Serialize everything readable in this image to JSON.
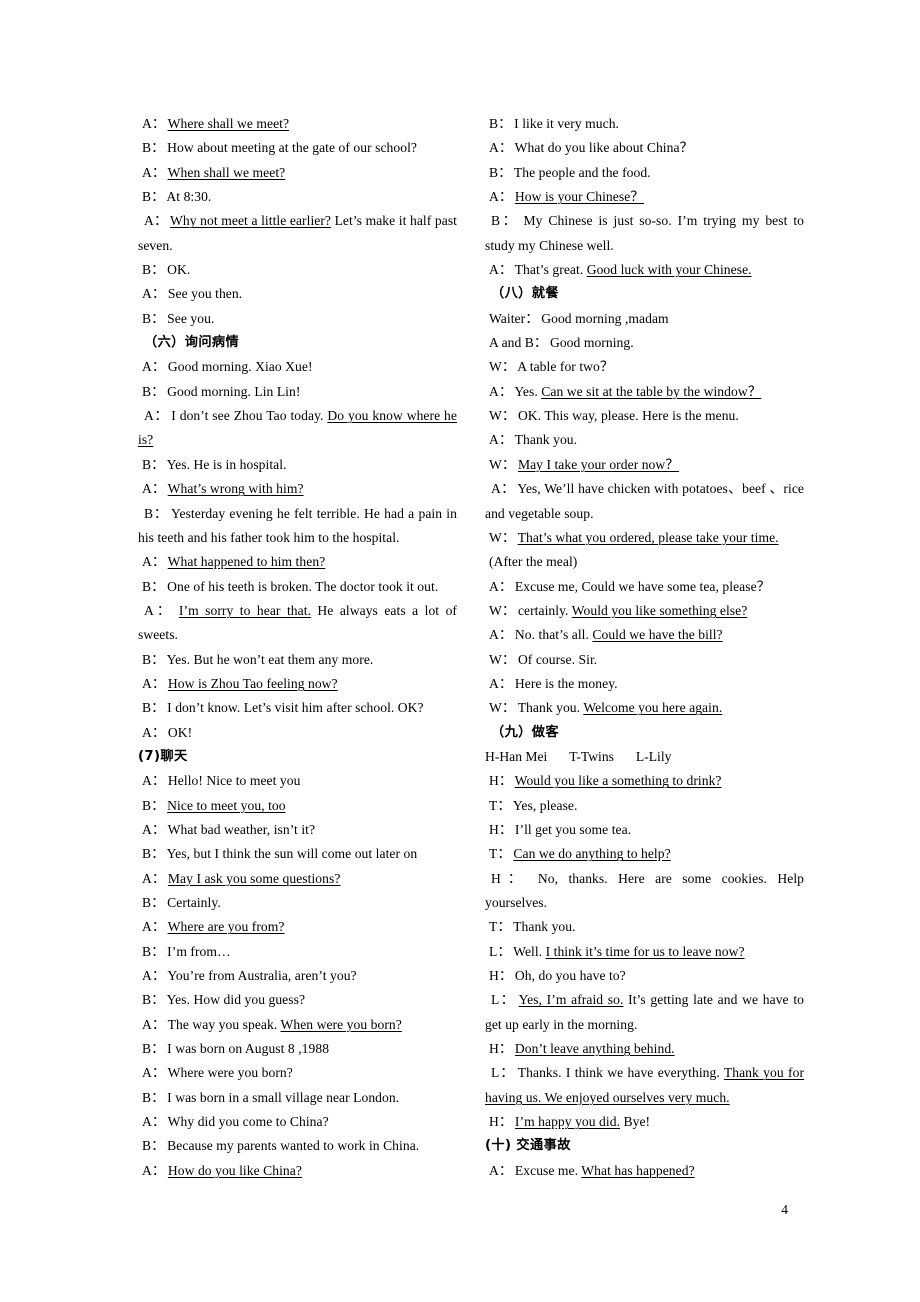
{
  "document": {
    "page_number": "4",
    "language_mix": "English dialogues with Chinese section headings"
  },
  "left_column": [
    {
      "type": "line",
      "speaker": "A",
      "sep": "：",
      "segments": [
        {
          "text": "Where shall we meet?",
          "underline": true
        }
      ]
    },
    {
      "type": "line",
      "speaker": "B",
      "sep": "：",
      "segments": [
        {
          "text": "How about meeting at the gate of our school?",
          "underline": false
        }
      ]
    },
    {
      "type": "line",
      "speaker": "A",
      "sep": "：",
      "segments": [
        {
          "text": "When shall we meet?",
          "underline": true
        }
      ]
    },
    {
      "type": "line",
      "speaker": "B",
      "sep": "：",
      "segments": [
        {
          "text": "At 8:30.",
          "underline": false
        }
      ]
    },
    {
      "type": "justify",
      "speaker": "A",
      "sep": "：",
      "segments": [
        {
          "text": "Why not meet a little earlier?",
          "underline": true
        },
        {
          "text": " Let’s make it half past seven.",
          "underline": false
        }
      ]
    },
    {
      "type": "line",
      "speaker": "B",
      "sep": "：",
      "segments": [
        {
          "text": "OK.",
          "underline": false
        }
      ]
    },
    {
      "type": "line",
      "speaker": "A",
      "sep": "：",
      "segments": [
        {
          "text": "See you then.",
          "underline": false
        }
      ]
    },
    {
      "type": "line",
      "speaker": "B",
      "sep": "：",
      "segments": [
        {
          "text": "See you.",
          "underline": false
        }
      ]
    },
    {
      "type": "heading",
      "text": "（六）询问病情"
    },
    {
      "type": "line",
      "speaker": "A",
      "sep": "：",
      "segments": [
        {
          "text": "Good morning. Xiao Xue!",
          "underline": false
        }
      ]
    },
    {
      "type": "line",
      "speaker": "B",
      "sep": "：",
      "segments": [
        {
          "text": "Good morning. Lin Lin!",
          "underline": false
        }
      ]
    },
    {
      "type": "justify",
      "speaker": "A",
      "sep": "：",
      "segments": [
        {
          "text": "I don’t see Zhou Tao today. ",
          "underline": false
        },
        {
          "text": "Do you know where he is?",
          "underline": true
        }
      ]
    },
    {
      "type": "line",
      "speaker": "B",
      "sep": "：",
      "segments": [
        {
          "text": "Yes. He is in hospital.",
          "underline": false
        }
      ]
    },
    {
      "type": "line",
      "speaker": "A",
      "sep": "：",
      "segments": [
        {
          "text": "What’s wrong with him?",
          "underline": true
        }
      ]
    },
    {
      "type": "justify",
      "speaker": "B",
      "sep": "：",
      "segments": [
        {
          "text": "Yesterday evening he felt terrible. He had a pain in his teeth and his father took him to the hospital.",
          "underline": false
        }
      ]
    },
    {
      "type": "line",
      "speaker": "A",
      "sep": "：",
      "segments": [
        {
          "text": "What happened to him then?",
          "underline": true
        }
      ]
    },
    {
      "type": "line",
      "speaker": "B",
      "sep": "：",
      "segments": [
        {
          "text": "One of his teeth is broken. The doctor took it out.",
          "underline": false
        }
      ]
    },
    {
      "type": "justify",
      "speaker": "A",
      "sep": "：",
      "segments": [
        {
          "text": "I’m sorry to hear that.",
          "underline": true
        },
        {
          "text": " He always eats a lot of sweets.",
          "underline": false
        }
      ]
    },
    {
      "type": "line",
      "speaker": "B",
      "sep": "：",
      "segments": [
        {
          "text": "Yes. But he won’t eat them any more.",
          "underline": false
        }
      ]
    },
    {
      "type": "line",
      "speaker": "A",
      "sep": "：",
      "segments": [
        {
          "text": "How is Zhou Tao feeling now?",
          "underline": true
        }
      ]
    },
    {
      "type": "line",
      "speaker": "B",
      "sep": "：",
      "segments": [
        {
          "text": "I don’t know. Let’s visit him after school. OK?",
          "underline": false
        }
      ]
    },
    {
      "type": "line",
      "speaker": "A",
      "sep": "：",
      "segments": [
        {
          "text": "OK!",
          "underline": false
        }
      ]
    },
    {
      "type": "heading",
      "text": "(7)聊天",
      "nopad": true
    },
    {
      "type": "line",
      "speaker": "A",
      "sep": "：",
      "segments": [
        {
          "text": "Hello! Nice to meet you",
          "underline": false
        }
      ]
    },
    {
      "type": "line",
      "speaker": "B",
      "sep": "：",
      "segments": [
        {
          "text": "Nice to meet you, too",
          "underline": true
        }
      ]
    },
    {
      "type": "line",
      "speaker": "A",
      "sep": "：",
      "segments": [
        {
          "text": "What bad weather, isn’t it?",
          "underline": false
        }
      ]
    },
    {
      "type": "line",
      "speaker": "B",
      "sep": "：",
      "segments": [
        {
          "text": "Yes, but I think the sun will come out later on",
          "underline": false
        }
      ]
    },
    {
      "type": "line",
      "speaker": "A",
      "sep": "：",
      "segments": [
        {
          "text": "May I ask you some questions?",
          "underline": true
        }
      ]
    },
    {
      "type": "line",
      "speaker": "B",
      "sep": "：",
      "segments": [
        {
          "text": "Certainly.",
          "underline": false
        }
      ]
    },
    {
      "type": "line",
      "speaker": "A",
      "sep": "：",
      "segments": [
        {
          "text": "Where are you from?",
          "underline": true
        }
      ]
    },
    {
      "type": "line",
      "speaker": "B",
      "sep": "：",
      "segments": [
        {
          "text": "I’m from…",
          "underline": false
        }
      ]
    },
    {
      "type": "line",
      "speaker": "A",
      "sep": "：",
      "segments": [
        {
          "text": "You’re from Australia, aren’t you?",
          "underline": false
        }
      ]
    },
    {
      "type": "line",
      "speaker": "B",
      "sep": "：",
      "segments": [
        {
          "text": "Yes. How did you guess?",
          "underline": false
        }
      ]
    },
    {
      "type": "line",
      "speaker": "A",
      "sep": "：",
      "segments": [
        {
          "text": "The way you speak. ",
          "underline": false
        },
        {
          "text": "When were you born?",
          "underline": true
        }
      ]
    },
    {
      "type": "line",
      "speaker": "B",
      "sep": "：",
      "segments": [
        {
          "text": "I was born on August 8 ,1988",
          "underline": false
        }
      ]
    },
    {
      "type": "line",
      "speaker": "A",
      "sep": "：",
      "segments": [
        {
          "text": "Where were you born?",
          "underline": false
        }
      ]
    },
    {
      "type": "line",
      "speaker": "B",
      "sep": "：",
      "segments": [
        {
          "text": "I was born in a small village near London.",
          "underline": false
        }
      ]
    },
    {
      "type": "line",
      "speaker": "A",
      "sep": "：",
      "segments": [
        {
          "text": "Why did you come to China?",
          "underline": false
        }
      ]
    },
    {
      "type": "line",
      "speaker": "B",
      "sep": "：",
      "segments": [
        {
          "text": "Because my parents wanted to work in China.",
          "underline": false
        }
      ]
    },
    {
      "type": "line",
      "speaker": "A",
      "sep": "：",
      "segments": [
        {
          "text": "How do you like China?",
          "underline": true
        }
      ]
    }
  ],
  "right_column": [
    {
      "type": "line",
      "speaker": "B",
      "sep": "：",
      "segments": [
        {
          "text": "I like it very much.",
          "underline": false
        }
      ]
    },
    {
      "type": "line",
      "speaker": "A",
      "sep": "：",
      "segments": [
        {
          "text": "What do you like about China？",
          "underline": false
        }
      ]
    },
    {
      "type": "line",
      "speaker": "B",
      "sep": "：",
      "segments": [
        {
          "text": "The people and the food.",
          "underline": false
        }
      ]
    },
    {
      "type": "line",
      "speaker": "A",
      "sep": "：",
      "segments": [
        {
          "text": "How is your Chinese？ ",
          "underline": true
        }
      ]
    },
    {
      "type": "justify",
      "speaker": "B",
      "sep": "：",
      "segments": [
        {
          "text": "My Chinese is just so-so. I’m trying my best to study my Chinese well.",
          "underline": false
        }
      ]
    },
    {
      "type": "line",
      "speaker": "A",
      "sep": "：",
      "segments": [
        {
          "text": "That’s great. ",
          "underline": false
        },
        {
          "text": "Good luck with your Chinese.",
          "underline": true
        }
      ]
    },
    {
      "type": "heading",
      "text": "（八）就餐"
    },
    {
      "type": "line",
      "speaker": "Waiter",
      "sep": "：",
      "segments": [
        {
          "text": "Good morning ,madam",
          "underline": false
        }
      ]
    },
    {
      "type": "line",
      "speaker": "A and B",
      "sep": "：",
      "segments": [
        {
          "text": "Good morning.",
          "underline": false
        }
      ]
    },
    {
      "type": "line",
      "speaker": "W",
      "sep": "：",
      "segments": [
        {
          "text": "A table for two？",
          "underline": false
        }
      ]
    },
    {
      "type": "line",
      "speaker": "A",
      "sep": "：",
      "segments": [
        {
          "text": "Yes. ",
          "underline": false
        },
        {
          "text": "Can we sit at the table by the window？ ",
          "underline": true
        }
      ]
    },
    {
      "type": "line",
      "speaker": "W",
      "sep": "：",
      "segments": [
        {
          "text": "OK. This way, please. Here is the menu.",
          "underline": false
        }
      ]
    },
    {
      "type": "line",
      "speaker": "A",
      "sep": "：",
      "segments": [
        {
          "text": "Thank you.",
          "underline": false
        }
      ]
    },
    {
      "type": "line",
      "speaker": "W",
      "sep": "：",
      "segments": [
        {
          "text": "May I take your order now？ ",
          "underline": true
        }
      ]
    },
    {
      "type": "justify",
      "speaker": "A",
      "sep": "：",
      "segments": [
        {
          "text": "Yes, We’ll have chicken with potatoes、beef 、rice and vegetable soup.",
          "underline": false
        }
      ]
    },
    {
      "type": "line",
      "speaker": "W",
      "sep": "：",
      "segments": [
        {
          "text": "That’s what you ordered, please take your time.",
          "underline": true
        }
      ]
    },
    {
      "type": "plain",
      "text": "(After the meal)"
    },
    {
      "type": "line",
      "speaker": "A",
      "sep": "：",
      "segments": [
        {
          "text": "Excuse me, Could we have some tea, please？",
          "underline": false
        }
      ]
    },
    {
      "type": "line",
      "speaker": "W",
      "sep": "：",
      "segments": [
        {
          "text": "certainly. ",
          "underline": false
        },
        {
          "text": "Would you like something else?",
          "underline": true
        }
      ]
    },
    {
      "type": "line",
      "speaker": "A",
      "sep": "：",
      "segments": [
        {
          "text": "No. that’s all. ",
          "underline": false
        },
        {
          "text": "Could we have the bill?",
          "underline": true
        }
      ]
    },
    {
      "type": "line",
      "speaker": "W",
      "sep": "：",
      "segments": [
        {
          "text": "Of course. Sir.",
          "underline": false
        }
      ]
    },
    {
      "type": "line",
      "speaker": "A",
      "sep": "：",
      "segments": [
        {
          "text": "Here is the money.",
          "underline": false
        }
      ]
    },
    {
      "type": "line",
      "speaker": "W",
      "sep": "：",
      "segments": [
        {
          "text": "Thank you. ",
          "underline": false
        },
        {
          "text": "Welcome you here again.",
          "underline": true
        }
      ]
    },
    {
      "type": "heading",
      "text": "（九）做客"
    },
    {
      "type": "roles",
      "roles": [
        "H-Han Mei",
        "T-Twins",
        "L-Lily"
      ]
    },
    {
      "type": "line",
      "speaker": "H",
      "sep": "：",
      "segments": [
        {
          "text": "Would you like a something to drink?",
          "underline": true
        }
      ]
    },
    {
      "type": "line",
      "speaker": "T",
      "sep": "：",
      "segments": [
        {
          "text": "Yes, please.",
          "underline": false
        }
      ]
    },
    {
      "type": "line",
      "speaker": "H",
      "sep": "：",
      "segments": [
        {
          "text": "I’ll get you some tea.",
          "underline": false
        }
      ]
    },
    {
      "type": "line",
      "speaker": "T",
      "sep": "：",
      "segments": [
        {
          "text": "Can we do anything to help?",
          "underline": true
        }
      ]
    },
    {
      "type": "justify",
      "speaker": "H",
      "sep": "：",
      "segments": [
        {
          "text": "No, thanks. Here are some cookies. Help yourselves.",
          "underline": false
        }
      ]
    },
    {
      "type": "line",
      "speaker": "T",
      "sep": "：",
      "segments": [
        {
          "text": "Thank you.",
          "underline": false
        }
      ]
    },
    {
      "type": "line",
      "speaker": "L",
      "sep": "：",
      "segments": [
        {
          "text": "Well. ",
          "underline": false
        },
        {
          "text": "I think it’s time for us to leave now?",
          "underline": true
        }
      ]
    },
    {
      "type": "line",
      "speaker": "H",
      "sep": "：",
      "segments": [
        {
          "text": "Oh, do you have to?",
          "underline": false
        }
      ]
    },
    {
      "type": "justify",
      "speaker": "L",
      "sep": "：",
      "segments": [
        {
          "text": "Yes, I’m afraid so.",
          "underline": true
        },
        {
          "text": " It’s getting late and we have to get up early in the morning.",
          "underline": false
        }
      ]
    },
    {
      "type": "line",
      "speaker": "H",
      "sep": "：",
      "segments": [
        {
          "text": "Don’t leave anything behind.",
          "underline": true
        }
      ]
    },
    {
      "type": "justify",
      "speaker": "L",
      "sep": "：",
      "segments": [
        {
          "text": "Thanks. I think we have everything. ",
          "underline": false
        },
        {
          "text": "Thank you for having us. We enjoyed ourselves very much.",
          "underline": true
        }
      ]
    },
    {
      "type": "line",
      "speaker": "H",
      "sep": "：",
      "segments": [
        {
          "text": "I’m happy you did.",
          "underline": true
        },
        {
          "text": " Bye!",
          "underline": false
        }
      ]
    },
    {
      "type": "heading",
      "text": "(十) 交通事故",
      "nopad": true
    },
    {
      "type": "line",
      "speaker": "A",
      "sep": "：",
      "segments": [
        {
          "text": "Excuse me. ",
          "underline": false
        },
        {
          "text": "What has happened?",
          "underline": true
        }
      ]
    }
  ]
}
